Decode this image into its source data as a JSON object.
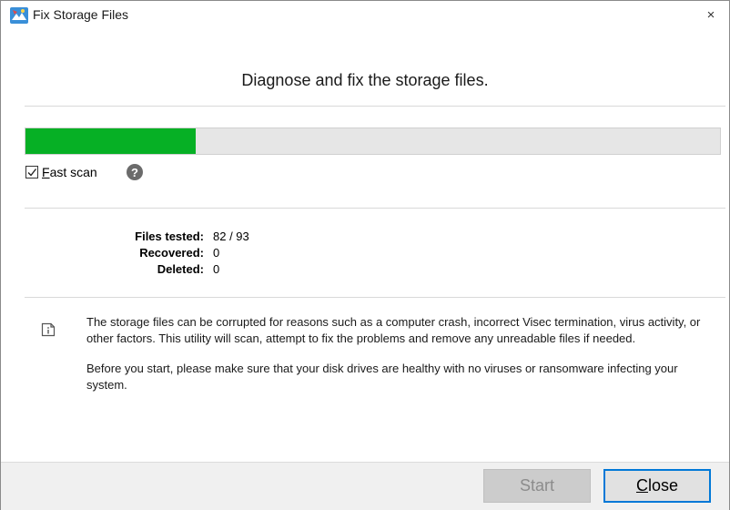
{
  "window": {
    "title": "Fix Storage Files",
    "close_glyph": "×"
  },
  "heading": "Diagnose and fix the storage files.",
  "progress": {
    "percent": 24.5,
    "color": "#06b025"
  },
  "fast_scan": {
    "label_accel": "F",
    "label_rest": "ast scan",
    "checked": true
  },
  "stats": {
    "files_tested_label": "Files tested:",
    "files_tested_value": "82 / 93",
    "recovered_label": "Recovered:",
    "recovered_value": "0",
    "deleted_label": "Deleted:",
    "deleted_value": "0"
  },
  "info": {
    "paragraph1": "The storage files can be corrupted for reasons such as a computer crash, incorrect Visec termination, virus activity, or other factors. This utility will scan, attempt to fix the problems and remove any unreadable files if needed.",
    "paragraph2": "Before you start, please make sure that your disk drives are healthy with no viruses or ransomware infecting your system."
  },
  "buttons": {
    "start_label": "Start",
    "close_accel": "C",
    "close_rest": "lose"
  },
  "icons": {
    "help": "question-icon",
    "info": "info-document-icon",
    "app": "app-icon"
  }
}
